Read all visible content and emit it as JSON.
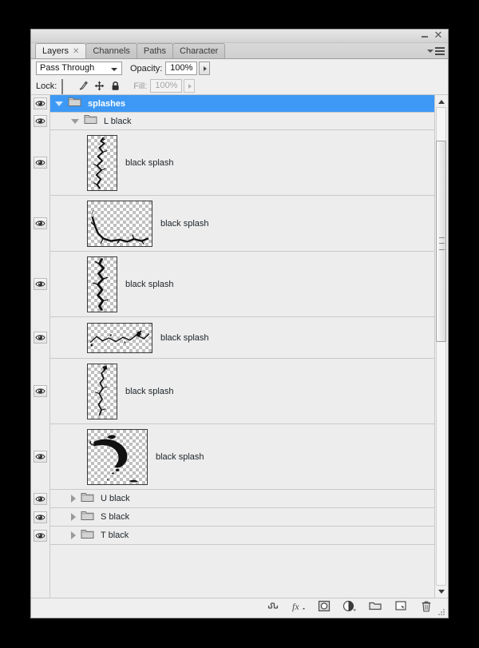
{
  "window": {
    "minimize_label": "",
    "close_label": "✕"
  },
  "tabs": [
    {
      "label": "Layers",
      "active": true,
      "closable": true,
      "close_glyph": "✕"
    },
    {
      "label": "Channels",
      "active": false,
      "closable": false
    },
    {
      "label": "Paths",
      "active": false,
      "closable": false
    },
    {
      "label": "Character",
      "active": false,
      "closable": false
    }
  ],
  "panel_menu": {
    "name": "panel-menu"
  },
  "blend_row": {
    "mode_value": "Pass Through",
    "opacity_label": "Opacity:",
    "opacity_value": "100%"
  },
  "lock_row": {
    "lock_label": "Lock:",
    "icons": [
      "transparency-lock-icon",
      "brush-lock-icon",
      "move-lock-icon",
      "all-lock-icon"
    ],
    "fill_label": "Fill:",
    "fill_value": "100%"
  },
  "colors": {
    "selection_blue": "#3d99f5",
    "panel_bg": "#ededed",
    "row_divider": "#c9c9c9",
    "text": "#20262b"
  },
  "layers": [
    {
      "type": "group",
      "name": "splashes",
      "indent": 0,
      "expanded": true,
      "selected": true,
      "visible": true
    },
    {
      "type": "group",
      "name": "L black",
      "indent": 1,
      "expanded": true,
      "selected": false,
      "visible": true
    },
    {
      "type": "layer",
      "name": "black splash",
      "indent": 2,
      "visible": true,
      "thumb": "tall-crack-1"
    },
    {
      "type": "layer",
      "name": "black splash",
      "indent": 2,
      "visible": true,
      "thumb": "wide-crack-2"
    },
    {
      "type": "layer",
      "name": "black splash",
      "indent": 2,
      "visible": true,
      "thumb": "tall-crack-3"
    },
    {
      "type": "layer",
      "name": "black splash",
      "indent": 2,
      "visible": true,
      "thumb": "short-wide-4"
    },
    {
      "type": "layer",
      "name": "black splash",
      "indent": 2,
      "visible": true,
      "thumb": "tall-crack-5"
    },
    {
      "type": "layer",
      "name": "black splash",
      "indent": 2,
      "visible": true,
      "thumb": "blob-splash-6"
    },
    {
      "type": "group",
      "name": "U black",
      "indent": 1,
      "expanded": false,
      "selected": false,
      "visible": true
    },
    {
      "type": "group",
      "name": "S black",
      "indent": 1,
      "expanded": false,
      "selected": false,
      "visible": true
    },
    {
      "type": "group",
      "name": "T black",
      "indent": 1,
      "expanded": false,
      "selected": false,
      "visible": true
    }
  ],
  "scrollbar": {
    "up_arrow": "scroll-up-arrow",
    "down_arrow": "scroll-down-arrow",
    "thumb_top_pct": 7,
    "thumb_height_pct": 42
  },
  "bottom_toolbar": {
    "buttons": [
      {
        "name": "link-layers-icon",
        "tooltip": "Link layers"
      },
      {
        "name": "layer-style-fx-icon",
        "tooltip": "Add a layer style"
      },
      {
        "name": "add-layer-mask-icon",
        "tooltip": "Add layer mask"
      },
      {
        "name": "adjustment-layer-icon",
        "tooltip": "Create new fill or adjustment layer"
      },
      {
        "name": "new-group-icon",
        "tooltip": "Create a new group"
      },
      {
        "name": "new-layer-icon",
        "tooltip": "Create a new layer"
      },
      {
        "name": "delete-layer-icon",
        "tooltip": "Delete layer"
      }
    ]
  }
}
